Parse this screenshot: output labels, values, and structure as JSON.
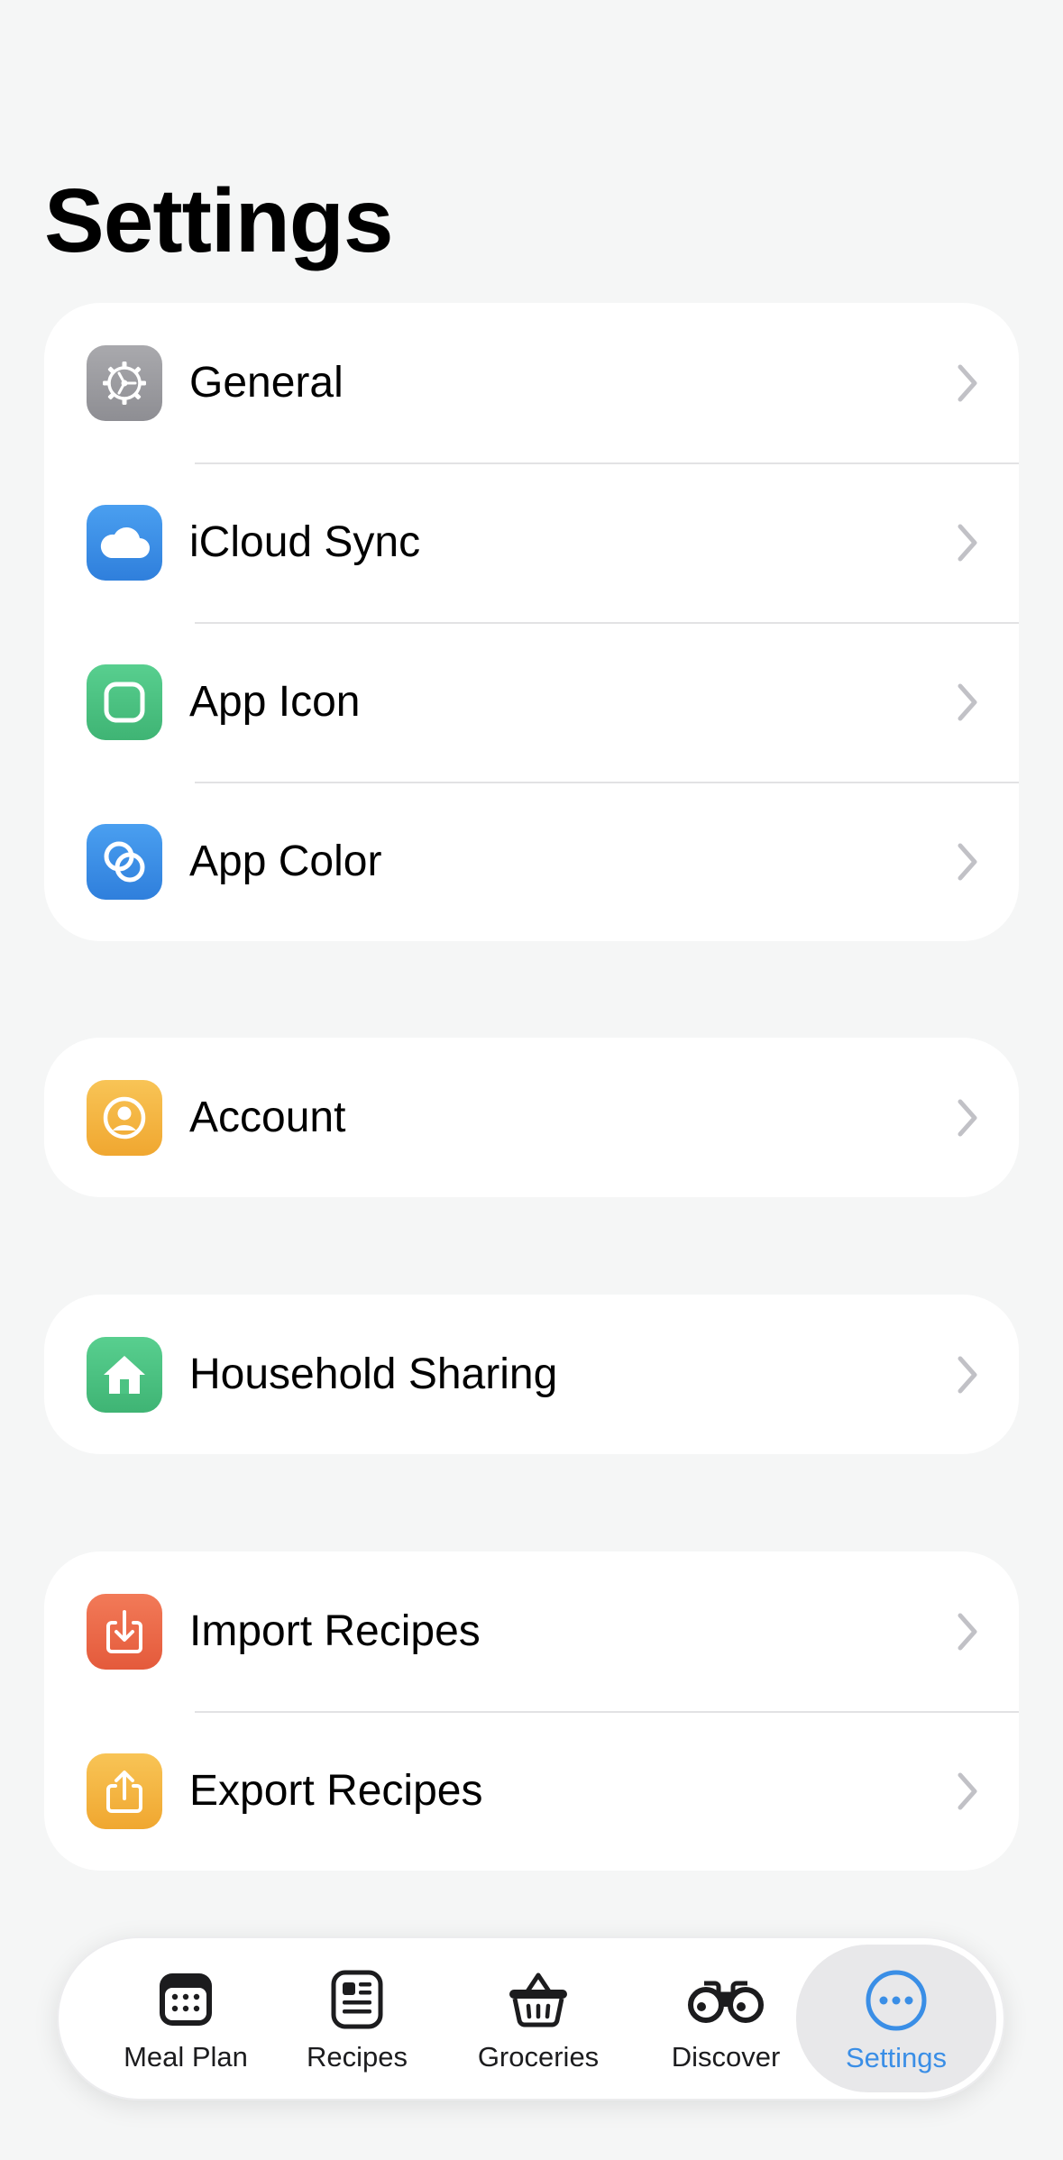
{
  "page": {
    "title": "Settings"
  },
  "groups": [
    {
      "rows": [
        {
          "label": "General",
          "icon": "gear-icon",
          "color": "#9a9a9e"
        },
        {
          "label": "iCloud Sync",
          "icon": "cloud-icon",
          "color": "#3a8ee6"
        },
        {
          "label": "App Icon",
          "icon": "app-square-icon",
          "color": "#4cc383"
        },
        {
          "label": "App Color",
          "icon": "overlapping-circles-icon",
          "color": "#3a8ee6"
        }
      ]
    },
    {
      "rows": [
        {
          "label": "Account",
          "icon": "person-circle-icon",
          "color": "#f5b642"
        }
      ]
    },
    {
      "rows": [
        {
          "label": "Household Sharing",
          "icon": "house-icon",
          "color": "#4cc383"
        }
      ]
    },
    {
      "rows": [
        {
          "label": "Import Recipes",
          "icon": "import-icon",
          "color": "#ec6a4a"
        },
        {
          "label": "Export Recipes",
          "icon": "export-icon",
          "color": "#f5b642"
        }
      ]
    }
  ],
  "tabbar": {
    "tabs": [
      {
        "label": "Meal Plan",
        "icon": "calendar-icon"
      },
      {
        "label": "Recipes",
        "icon": "recipe-card-icon"
      },
      {
        "label": "Groceries",
        "icon": "basket-icon"
      },
      {
        "label": "Discover",
        "icon": "binoculars-icon"
      },
      {
        "label": "Settings",
        "icon": "ellipsis-circle-icon",
        "active": true
      }
    ],
    "active_color": "#3a8ee6"
  }
}
